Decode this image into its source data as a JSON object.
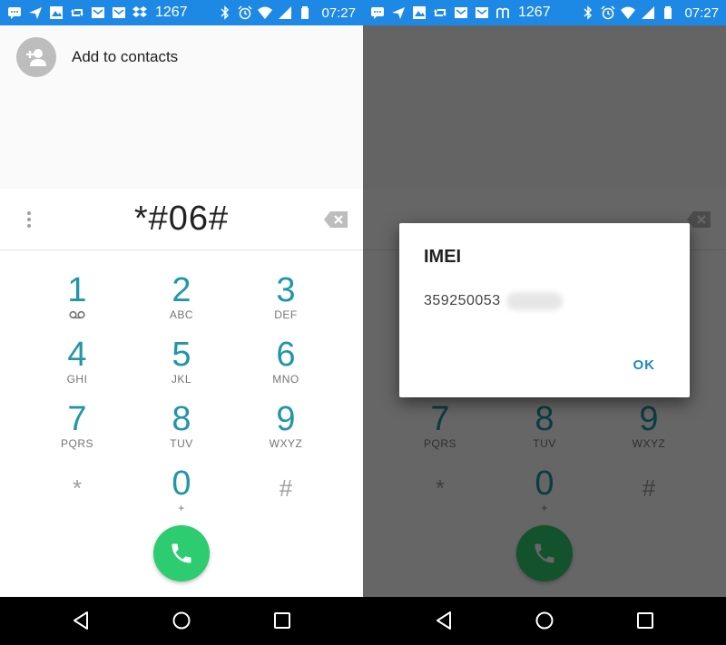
{
  "status_bar": {
    "left_count": "1267",
    "right_count": "1267",
    "time": "07:27",
    "color": "#1e88e5"
  },
  "contacts": {
    "add_label": "Add to contacts"
  },
  "dialer": {
    "digits": "*#06#",
    "keys": [
      {
        "num": "1",
        "sub": ""
      },
      {
        "num": "2",
        "sub": "ABC"
      },
      {
        "num": "3",
        "sub": "DEF"
      },
      {
        "num": "4",
        "sub": "GHI"
      },
      {
        "num": "5",
        "sub": "JKL"
      },
      {
        "num": "6",
        "sub": "MNO"
      },
      {
        "num": "7",
        "sub": "PQRS"
      },
      {
        "num": "8",
        "sub": "TUV"
      },
      {
        "num": "9",
        "sub": "WXYZ"
      },
      {
        "num": "*",
        "sub": ""
      },
      {
        "num": "0",
        "sub": "+"
      },
      {
        "num": "#",
        "sub": ""
      }
    ],
    "call_color": "#2ecc71"
  },
  "dialog": {
    "title": "IMEI",
    "value": "359250053",
    "ok_label": "OK"
  },
  "icons": {
    "status": [
      "message-icon",
      "send-icon",
      "image-icon",
      "retweet-icon",
      "mail-icon",
      "mail-icon",
      "dropbox-icon",
      "bluetooth-icon",
      "alarm-icon",
      "wifi-icon",
      "signal-icon",
      "battery-icon"
    ],
    "nav": [
      "back-icon",
      "home-icon",
      "recents-icon"
    ]
  }
}
